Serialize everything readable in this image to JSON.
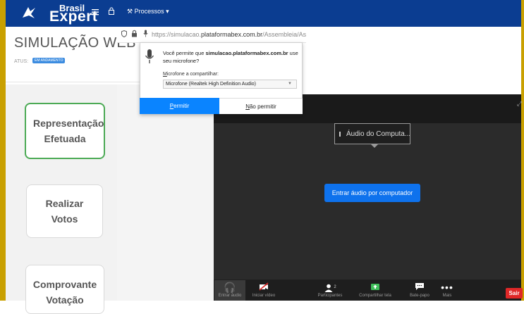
{
  "colors": {
    "nav": "#0b3d91",
    "gold": "#c9a000",
    "allow": "#0a84ff",
    "join": "#0e72ed",
    "exit": "#e02828",
    "active_card": "#4caa55"
  },
  "header": {
    "logo_brasil": "Brasil",
    "logo_expert": "Expert",
    "menu_icon": "hamburger-icon",
    "lock_icon": "lock-icon",
    "processos": "Processos ▾"
  },
  "page": {
    "title": "SIMULAÇÃO WEB - EM",
    "status_label": "ATUS:",
    "status_badge": "EM ANDAMENTO"
  },
  "cards": [
    {
      "label": "Representação Efetuada"
    },
    {
      "label": "Realizar Votos"
    },
    {
      "label": "Comprovante Votação"
    }
  ],
  "browser": {
    "url_prefix": "https://simulacao.",
    "url_domain": "plataformabex.com.br",
    "url_suffix": "/Assembleia/As"
  },
  "permission": {
    "question_pre": "Você permite que ",
    "question_site": "simulacao.plataformabex.com.br",
    "question_post": " use seu microfone?",
    "mic_label_first": "M",
    "mic_label_rest": "icrofone a compartilhar:",
    "mic_selected": "Microfone (Realtek High Definition Audio)",
    "allow_first": "P",
    "allow_rest": "ermitir",
    "deny_first": "N",
    "deny_rest": "ão permitir"
  },
  "zoom": {
    "tooltip": "Áudio do Computa...",
    "join_audio": "Entrar áudio por computador",
    "participants_count": "2",
    "toolbar": [
      {
        "icon": "headphones-icon",
        "label": "Entrar áudio"
      },
      {
        "icon": "video-off-icon",
        "label": "Iniciar vídeo"
      },
      {
        "icon": "participants-icon",
        "label": "Participantes"
      },
      {
        "icon": "share-screen-icon",
        "label": "Compartilhar tela"
      },
      {
        "icon": "chat-icon",
        "label": "Bate-papo"
      },
      {
        "icon": "more-icon",
        "label": "Mais"
      }
    ],
    "exit": "Sair"
  }
}
